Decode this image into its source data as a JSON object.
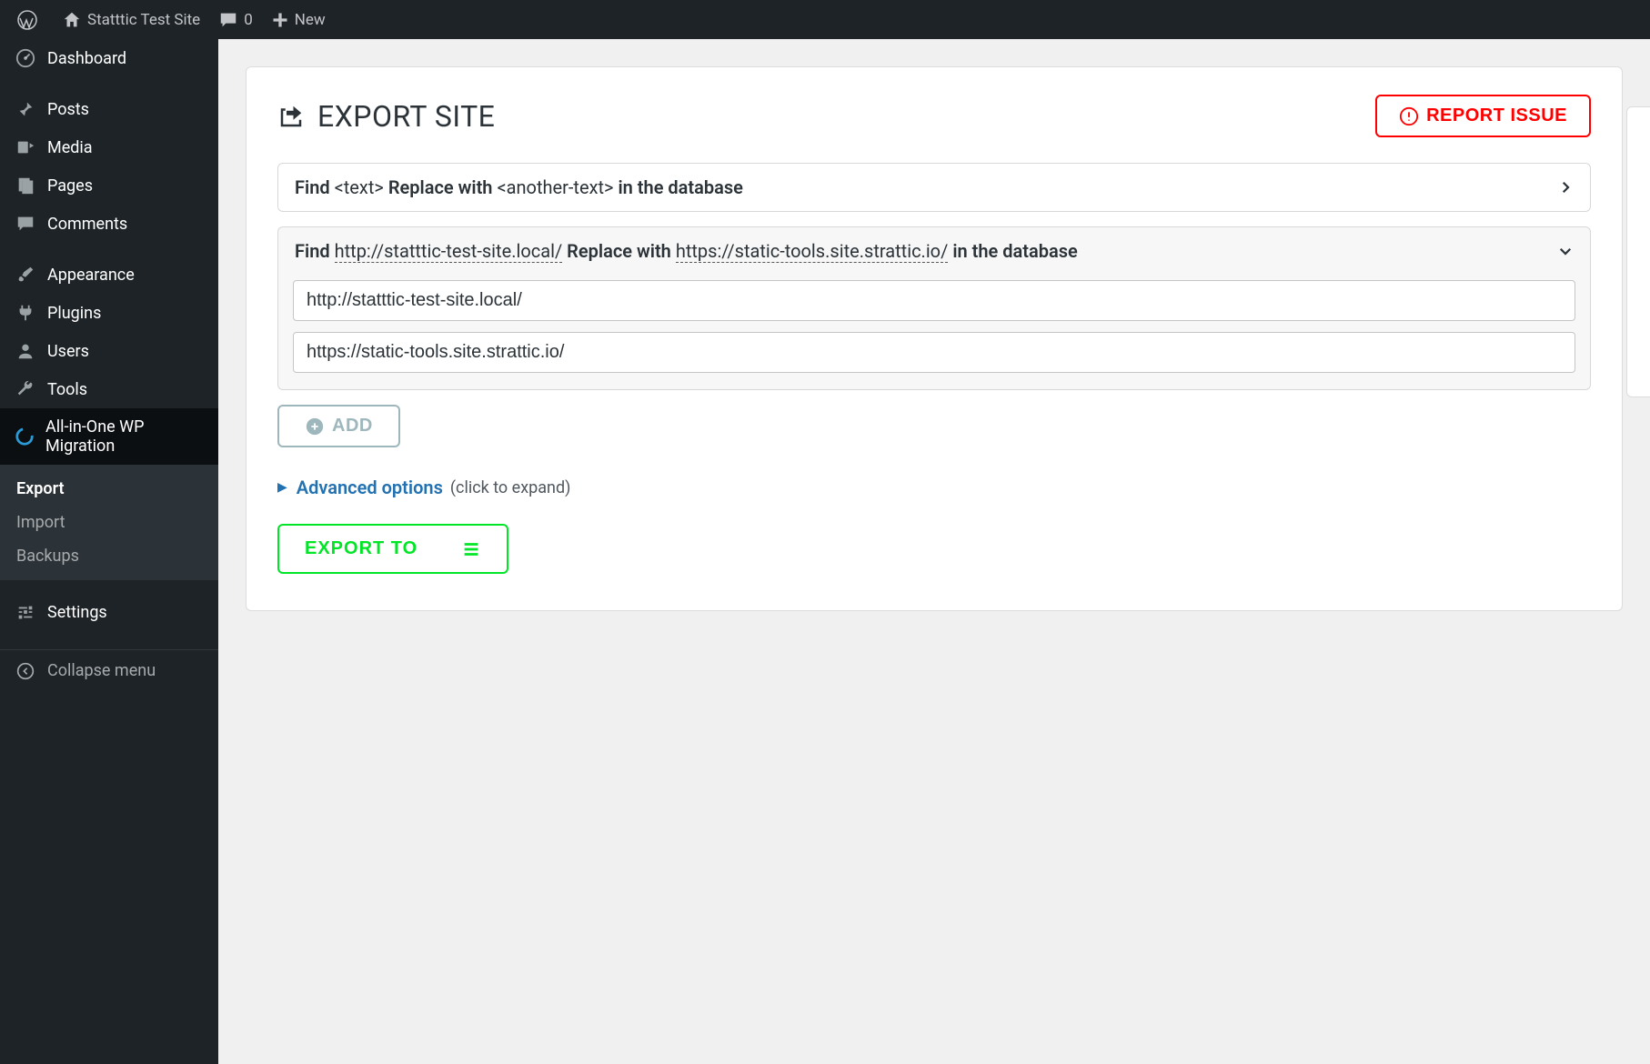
{
  "adminbar": {
    "site_title": "Statttic Test Site",
    "comments_count": "0",
    "new_label": "New"
  },
  "sidebar": {
    "items": [
      {
        "id": "dashboard",
        "label": "Dashboard",
        "icon": "dashboard-icon"
      },
      {
        "id": "posts",
        "label": "Posts",
        "icon": "pin-icon"
      },
      {
        "id": "media",
        "label": "Media",
        "icon": "media-icon"
      },
      {
        "id": "pages",
        "label": "Pages",
        "icon": "page-icon"
      },
      {
        "id": "comments",
        "label": "Comments",
        "icon": "comment-icon"
      },
      {
        "id": "appearance",
        "label": "Appearance",
        "icon": "brush-icon"
      },
      {
        "id": "plugins",
        "label": "Plugins",
        "icon": "plug-icon"
      },
      {
        "id": "users",
        "label": "Users",
        "icon": "user-icon"
      },
      {
        "id": "tools",
        "label": "Tools",
        "icon": "wrench-icon"
      },
      {
        "id": "aiowpm",
        "label": "All-in-One WP Migration",
        "icon": "migration-icon",
        "current": true
      },
      {
        "id": "settings",
        "label": "Settings",
        "icon": "sliders-icon"
      }
    ],
    "submenu": [
      {
        "id": "export",
        "label": "Export",
        "current": true
      },
      {
        "id": "import",
        "label": "Import"
      },
      {
        "id": "backups",
        "label": "Backups"
      }
    ],
    "collapse_label": "Collapse menu"
  },
  "panel": {
    "title": "EXPORT SITE",
    "report_issue_label": "REPORT ISSUE",
    "rule_collapsed": {
      "find_label": "Find",
      "find_placeholder": "<text>",
      "replace_label": "Replace with",
      "replace_placeholder": "<another-text>",
      "suffix": "in the database"
    },
    "rule_expanded": {
      "find_label": "Find",
      "find_url": "http://statttic-test-site.local/",
      "replace_label": "Replace with",
      "replace_url": "https://static-tools.site.strattic.io/",
      "suffix": "in the database",
      "input_find": "http://statttic-test-site.local/",
      "input_replace": "https://static-tools.site.strattic.io/"
    },
    "add_label": "ADD",
    "advanced_label": "Advanced options",
    "advanced_hint": "(click to expand)",
    "export_to_label": "EXPORT TO"
  }
}
